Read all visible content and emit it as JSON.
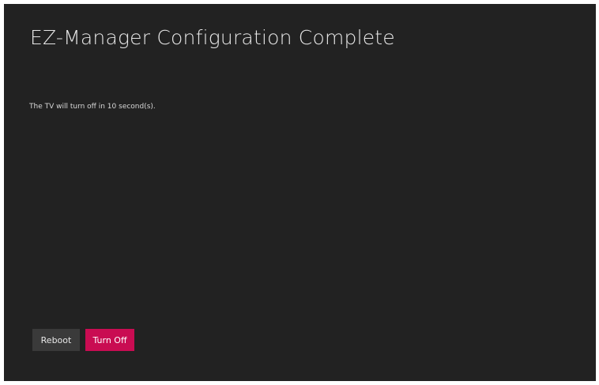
{
  "dialog": {
    "title": "EZ-Manager Configuration Complete",
    "message": "The TV will turn off in 10 second(s)."
  },
  "buttons": {
    "reboot_label": "Reboot",
    "turn_off_label": "Turn Off"
  },
  "colors": {
    "background": "#222222",
    "primary_accent": "#c90c52",
    "secondary_button": "#3a3a3a"
  }
}
